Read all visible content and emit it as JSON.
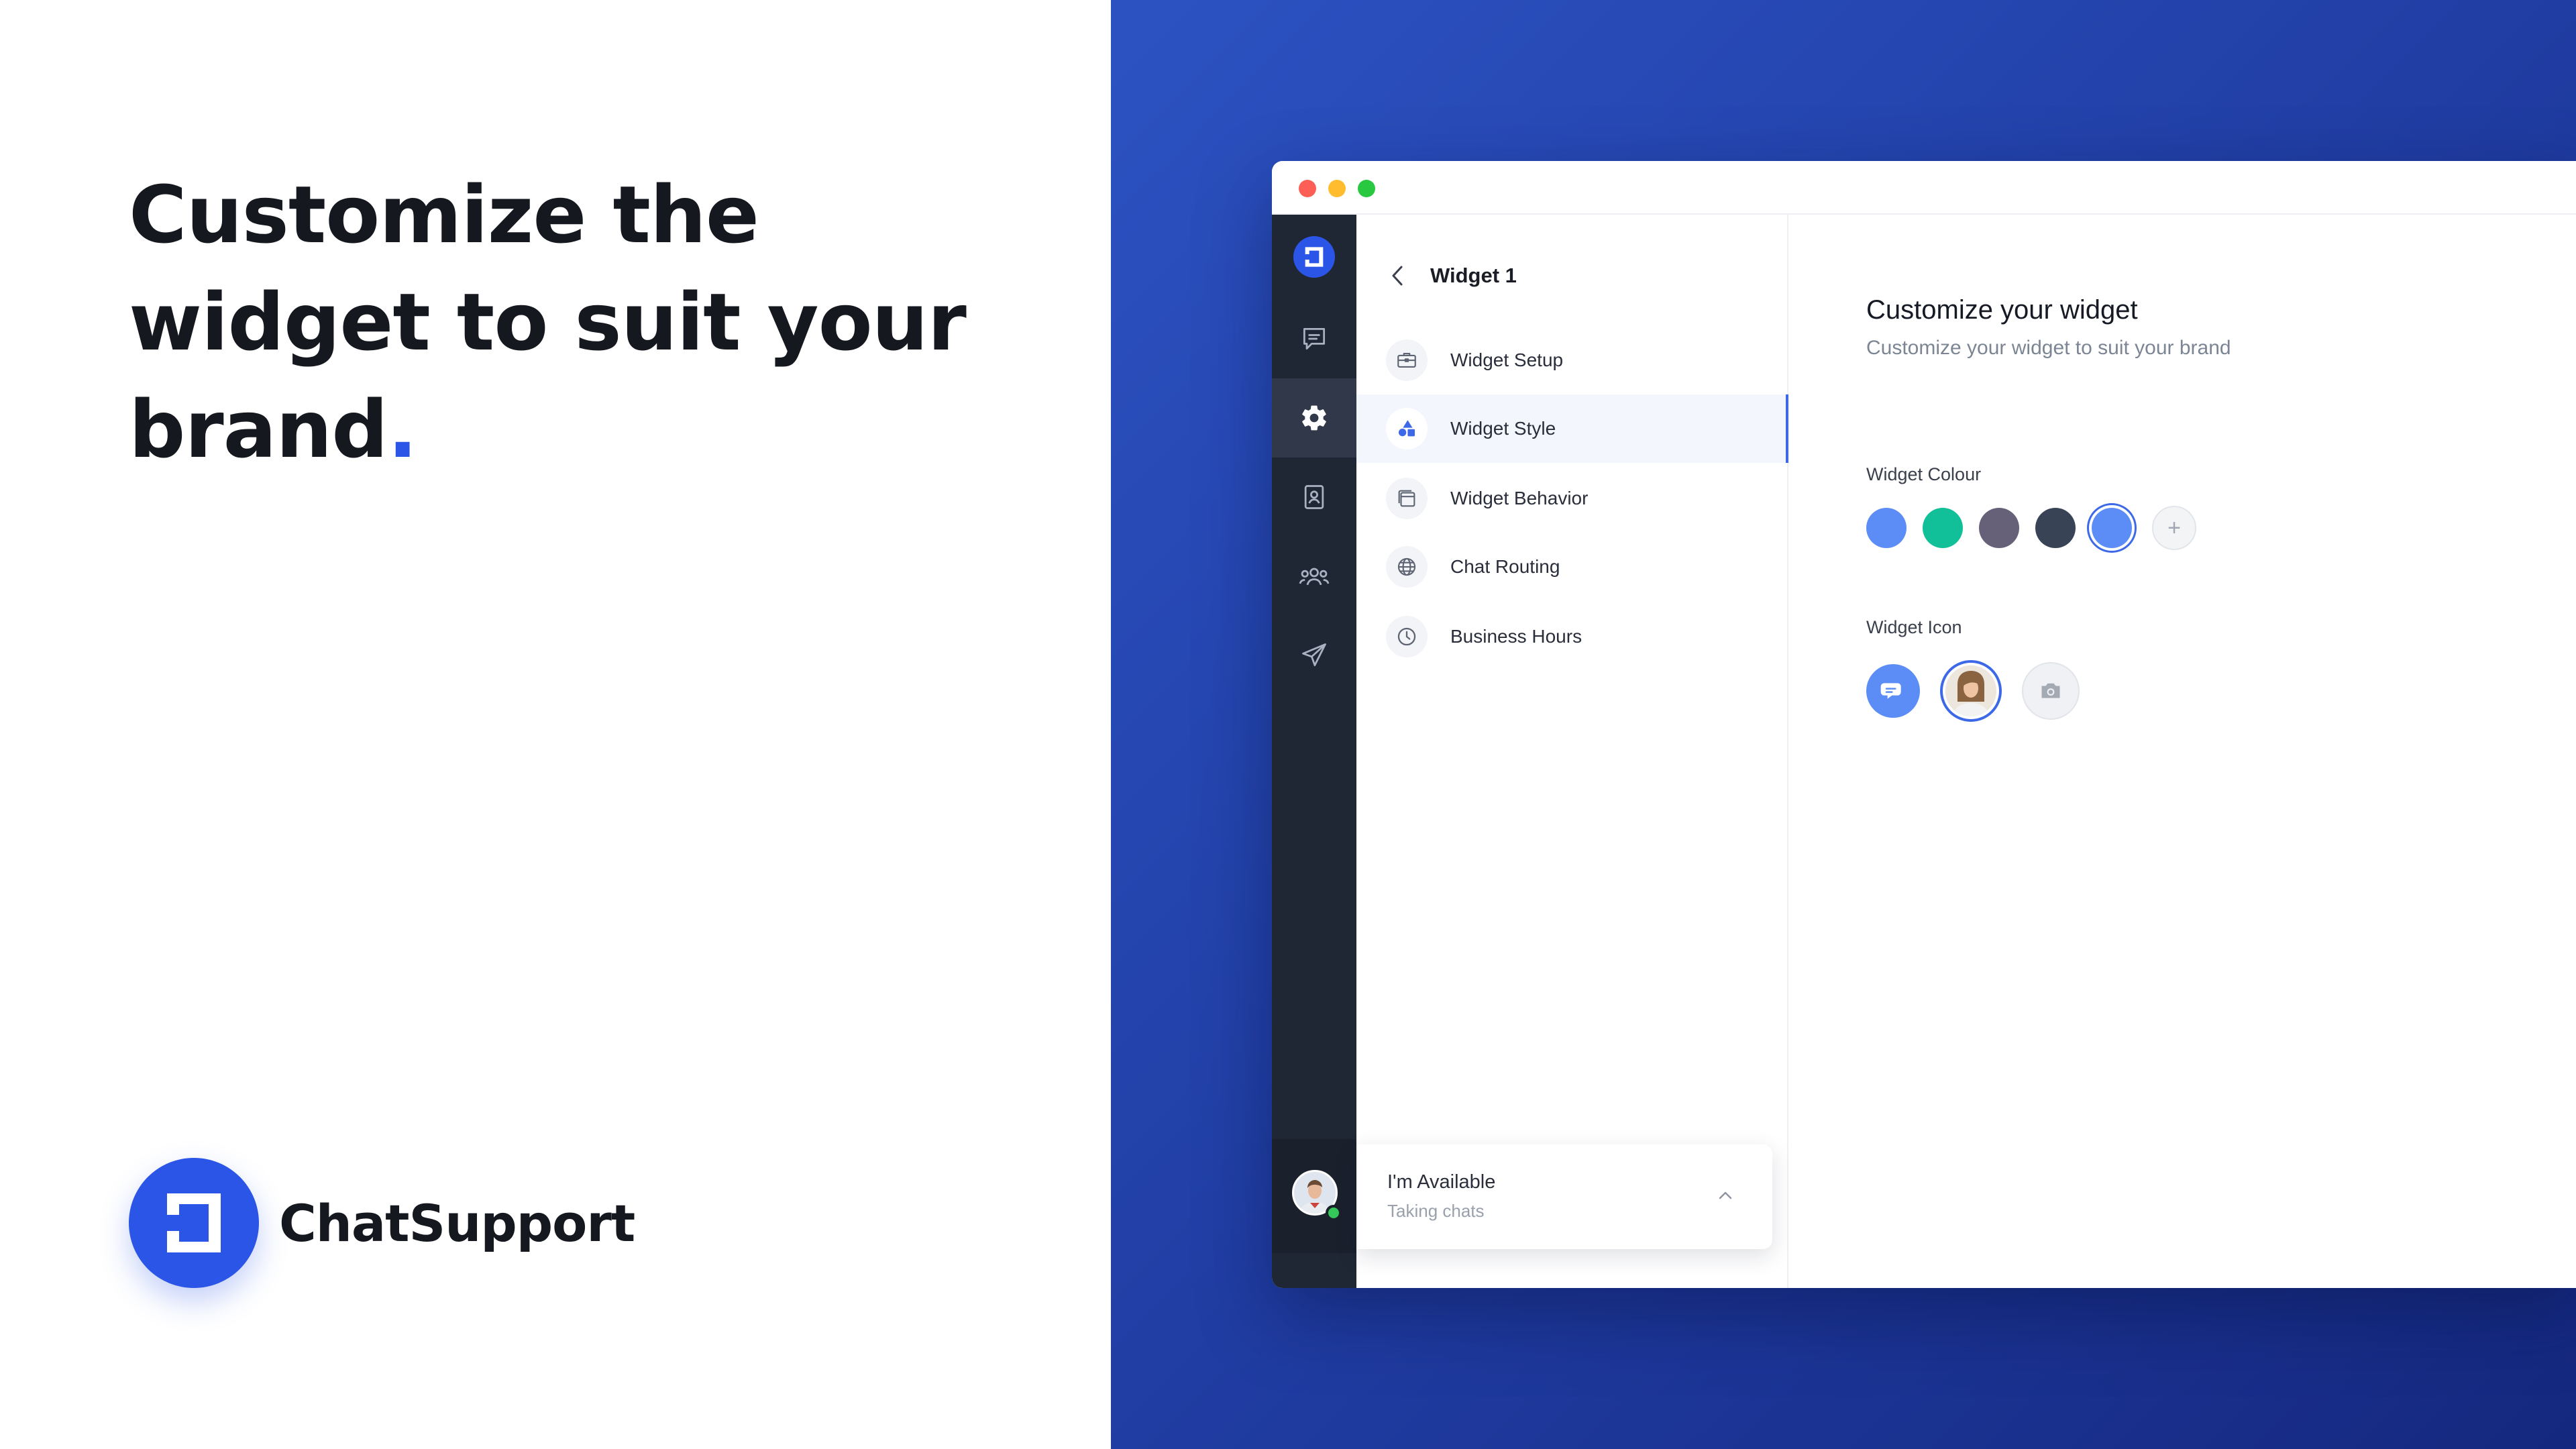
{
  "headline": {
    "line1": "Customize the",
    "line2": "widget to suit your",
    "line3": "brand",
    "dot": "."
  },
  "brand": {
    "name": "ChatSupport",
    "color": "#2b55e6"
  },
  "rail": {
    "items": [
      {
        "icon": "chat-icon",
        "active": false
      },
      {
        "icon": "gear-icon",
        "active": true
      },
      {
        "icon": "contact-book-icon",
        "active": false
      },
      {
        "icon": "team-icon",
        "active": false
      },
      {
        "icon": "send-icon",
        "active": false
      }
    ]
  },
  "menu": {
    "title": "Widget 1",
    "items": [
      {
        "label": "Widget Setup",
        "icon": "briefcase-icon",
        "active": false
      },
      {
        "label": "Widget Style",
        "icon": "shapes-icon",
        "active": true
      },
      {
        "label": "Widget Behavior",
        "icon": "windows-icon",
        "active": false
      },
      {
        "label": "Chat Routing",
        "icon": "globe-icon",
        "active": false
      },
      {
        "label": "Business Hours",
        "icon": "clock-icon",
        "active": false
      }
    ]
  },
  "status": {
    "title": "I'm Available",
    "subtitle": "Taking chats"
  },
  "content": {
    "title": "Customize your widget",
    "subtitle": "Customize your widget to suit your brand",
    "colour_label": "Widget Colour",
    "colours": [
      "#5c8df6",
      "#11bf98",
      "#666179",
      "#394356",
      "#5c8df6"
    ],
    "selected_colour_index": 4,
    "add_symbol": "+",
    "icon_label": "Widget Icon",
    "icons": [
      "chat-bubble-icon",
      "agent-photo",
      "camera-icon"
    ],
    "selected_icon_index": 1
  }
}
